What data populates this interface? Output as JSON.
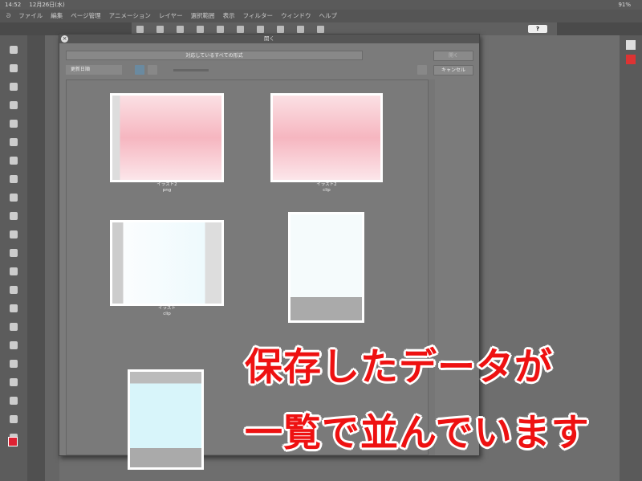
{
  "status": {
    "time": "14:52",
    "date": "12月26日(水)",
    "battery": "91%"
  },
  "menu": [
    "ファイル",
    "編集",
    "ページ管理",
    "アニメーション",
    "レイヤー",
    "選択範囲",
    "表示",
    "フィルター",
    "ウィンドウ",
    "ヘルプ"
  ],
  "help_label": "?",
  "dialog": {
    "title": "開く",
    "format": "対応しているすべての形式",
    "open_label": "開く",
    "cancel_label": "キャンセル",
    "sort": "更新日順",
    "files": [
      {
        "name": "イラスト2",
        "ext": "png"
      },
      {
        "name": "イラスト2",
        "ext": "clip"
      },
      {
        "name": "イラスト",
        "ext": "clip"
      },
      {
        "name": "",
        "ext": ""
      },
      {
        "name": "",
        "ext": ""
      }
    ]
  },
  "overlay": {
    "line1": "保存したデータが",
    "line2": "一覧で並んでいます"
  },
  "colors": {
    "accent": "#ee1111",
    "main": "#dd2233"
  }
}
